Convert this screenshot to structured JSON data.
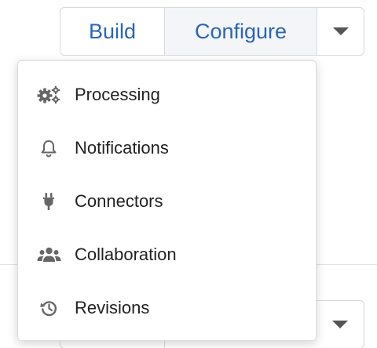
{
  "toolbar": {
    "build_label": "Build",
    "configure_label": "Configure"
  },
  "menu": {
    "items": [
      {
        "label": "Processing",
        "icon": "gears-icon"
      },
      {
        "label": "Notifications",
        "icon": "bell-icon"
      },
      {
        "label": "Connectors",
        "icon": "plug-icon"
      },
      {
        "label": "Collaboration",
        "icon": "users-icon"
      },
      {
        "label": "Revisions",
        "icon": "history-icon"
      }
    ]
  },
  "colors": {
    "accent": "#2a66b4",
    "icon": "#666666",
    "text": "#222222"
  }
}
